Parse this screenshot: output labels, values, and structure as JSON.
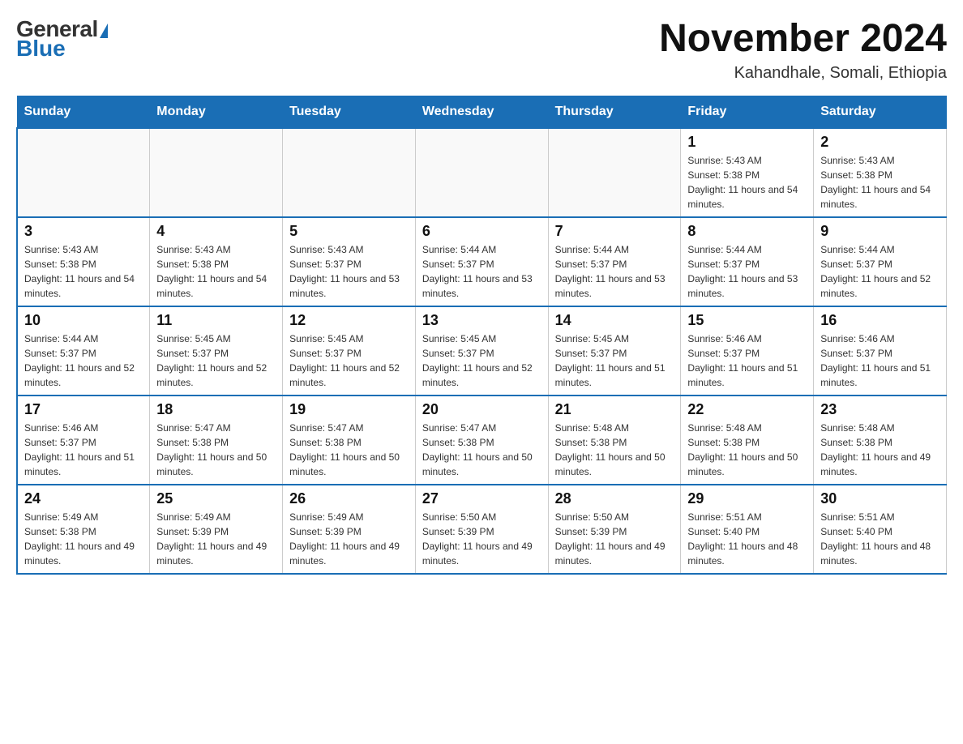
{
  "header": {
    "logo_general": "General",
    "logo_blue": "Blue",
    "month_title": "November 2024",
    "location": "Kahandhale, Somali, Ethiopia"
  },
  "days_of_week": [
    "Sunday",
    "Monday",
    "Tuesday",
    "Wednesday",
    "Thursday",
    "Friday",
    "Saturday"
  ],
  "weeks": [
    [
      {
        "day": "",
        "info": ""
      },
      {
        "day": "",
        "info": ""
      },
      {
        "day": "",
        "info": ""
      },
      {
        "day": "",
        "info": ""
      },
      {
        "day": "",
        "info": ""
      },
      {
        "day": "1",
        "info": "Sunrise: 5:43 AM\nSunset: 5:38 PM\nDaylight: 11 hours and 54 minutes."
      },
      {
        "day": "2",
        "info": "Sunrise: 5:43 AM\nSunset: 5:38 PM\nDaylight: 11 hours and 54 minutes."
      }
    ],
    [
      {
        "day": "3",
        "info": "Sunrise: 5:43 AM\nSunset: 5:38 PM\nDaylight: 11 hours and 54 minutes."
      },
      {
        "day": "4",
        "info": "Sunrise: 5:43 AM\nSunset: 5:38 PM\nDaylight: 11 hours and 54 minutes."
      },
      {
        "day": "5",
        "info": "Sunrise: 5:43 AM\nSunset: 5:37 PM\nDaylight: 11 hours and 53 minutes."
      },
      {
        "day": "6",
        "info": "Sunrise: 5:44 AM\nSunset: 5:37 PM\nDaylight: 11 hours and 53 minutes."
      },
      {
        "day": "7",
        "info": "Sunrise: 5:44 AM\nSunset: 5:37 PM\nDaylight: 11 hours and 53 minutes."
      },
      {
        "day": "8",
        "info": "Sunrise: 5:44 AM\nSunset: 5:37 PM\nDaylight: 11 hours and 53 minutes."
      },
      {
        "day": "9",
        "info": "Sunrise: 5:44 AM\nSunset: 5:37 PM\nDaylight: 11 hours and 52 minutes."
      }
    ],
    [
      {
        "day": "10",
        "info": "Sunrise: 5:44 AM\nSunset: 5:37 PM\nDaylight: 11 hours and 52 minutes."
      },
      {
        "day": "11",
        "info": "Sunrise: 5:45 AM\nSunset: 5:37 PM\nDaylight: 11 hours and 52 minutes."
      },
      {
        "day": "12",
        "info": "Sunrise: 5:45 AM\nSunset: 5:37 PM\nDaylight: 11 hours and 52 minutes."
      },
      {
        "day": "13",
        "info": "Sunrise: 5:45 AM\nSunset: 5:37 PM\nDaylight: 11 hours and 52 minutes."
      },
      {
        "day": "14",
        "info": "Sunrise: 5:45 AM\nSunset: 5:37 PM\nDaylight: 11 hours and 51 minutes."
      },
      {
        "day": "15",
        "info": "Sunrise: 5:46 AM\nSunset: 5:37 PM\nDaylight: 11 hours and 51 minutes."
      },
      {
        "day": "16",
        "info": "Sunrise: 5:46 AM\nSunset: 5:37 PM\nDaylight: 11 hours and 51 minutes."
      }
    ],
    [
      {
        "day": "17",
        "info": "Sunrise: 5:46 AM\nSunset: 5:37 PM\nDaylight: 11 hours and 51 minutes."
      },
      {
        "day": "18",
        "info": "Sunrise: 5:47 AM\nSunset: 5:38 PM\nDaylight: 11 hours and 50 minutes."
      },
      {
        "day": "19",
        "info": "Sunrise: 5:47 AM\nSunset: 5:38 PM\nDaylight: 11 hours and 50 minutes."
      },
      {
        "day": "20",
        "info": "Sunrise: 5:47 AM\nSunset: 5:38 PM\nDaylight: 11 hours and 50 minutes."
      },
      {
        "day": "21",
        "info": "Sunrise: 5:48 AM\nSunset: 5:38 PM\nDaylight: 11 hours and 50 minutes."
      },
      {
        "day": "22",
        "info": "Sunrise: 5:48 AM\nSunset: 5:38 PM\nDaylight: 11 hours and 50 minutes."
      },
      {
        "day": "23",
        "info": "Sunrise: 5:48 AM\nSunset: 5:38 PM\nDaylight: 11 hours and 49 minutes."
      }
    ],
    [
      {
        "day": "24",
        "info": "Sunrise: 5:49 AM\nSunset: 5:38 PM\nDaylight: 11 hours and 49 minutes."
      },
      {
        "day": "25",
        "info": "Sunrise: 5:49 AM\nSunset: 5:39 PM\nDaylight: 11 hours and 49 minutes."
      },
      {
        "day": "26",
        "info": "Sunrise: 5:49 AM\nSunset: 5:39 PM\nDaylight: 11 hours and 49 minutes."
      },
      {
        "day": "27",
        "info": "Sunrise: 5:50 AM\nSunset: 5:39 PM\nDaylight: 11 hours and 49 minutes."
      },
      {
        "day": "28",
        "info": "Sunrise: 5:50 AM\nSunset: 5:39 PM\nDaylight: 11 hours and 49 minutes."
      },
      {
        "day": "29",
        "info": "Sunrise: 5:51 AM\nSunset: 5:40 PM\nDaylight: 11 hours and 48 minutes."
      },
      {
        "day": "30",
        "info": "Sunrise: 5:51 AM\nSunset: 5:40 PM\nDaylight: 11 hours and 48 minutes."
      }
    ]
  ]
}
